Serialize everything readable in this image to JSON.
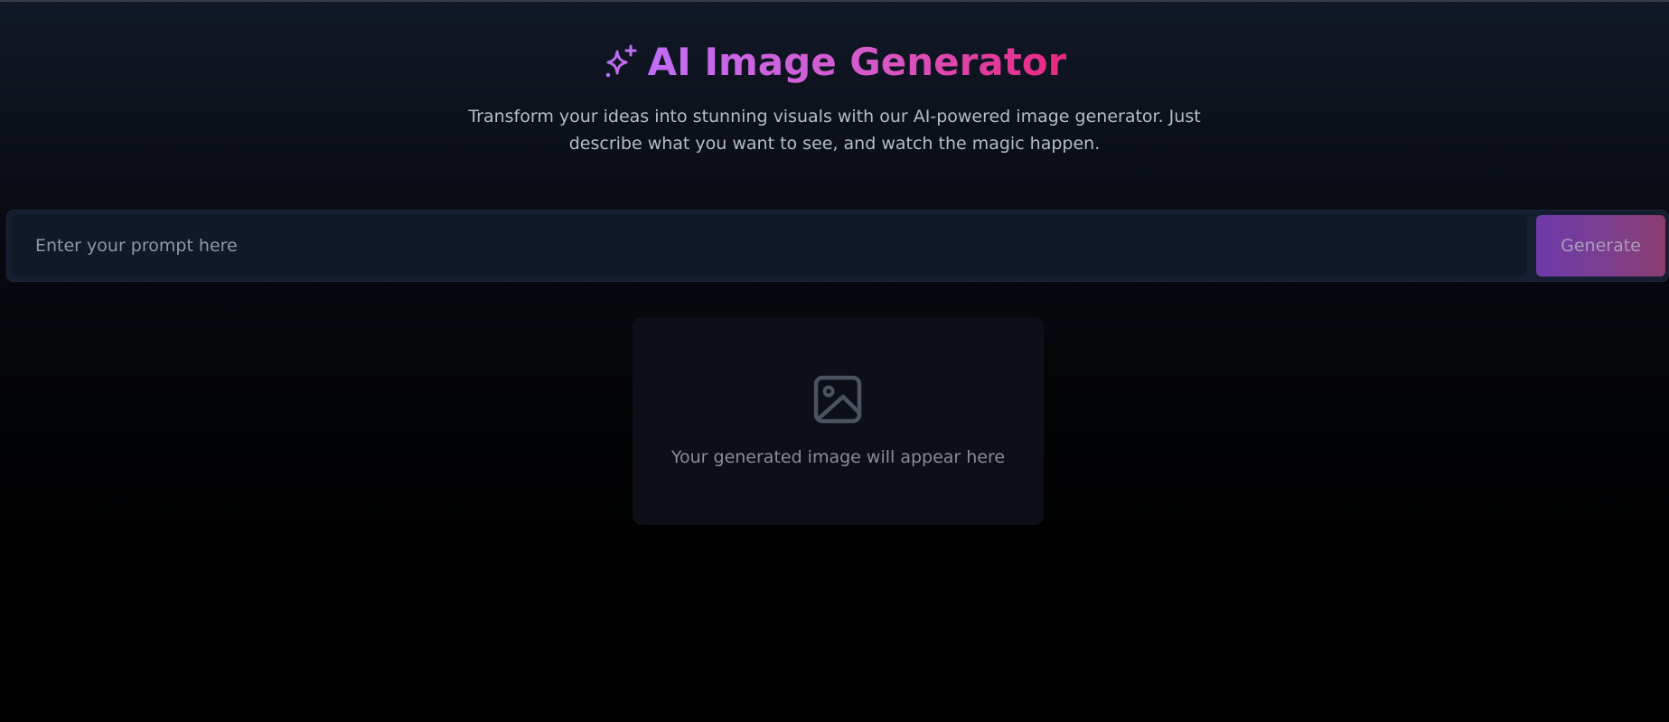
{
  "app": {
    "title": "AI Image Generator",
    "subtitle": "Transform your ideas into stunning visuals with our AI-powered image generator. Just describe what you want to see, and watch the magic happen.",
    "title_icon": "sparkles-icon"
  },
  "prompt": {
    "placeholder": "Enter your prompt here",
    "value": "",
    "button_label": "Generate"
  },
  "preview": {
    "icon": "image-icon",
    "empty_text": "Your generated image will appear here"
  },
  "colors": {
    "title_gradient_start": "#c06ef5",
    "title_gradient_end": "#e8287f",
    "button_gradient_start": "#6d3aa8",
    "button_gradient_end": "#8c3d6f",
    "background_top": "#111827",
    "background_bottom": "#000000"
  }
}
